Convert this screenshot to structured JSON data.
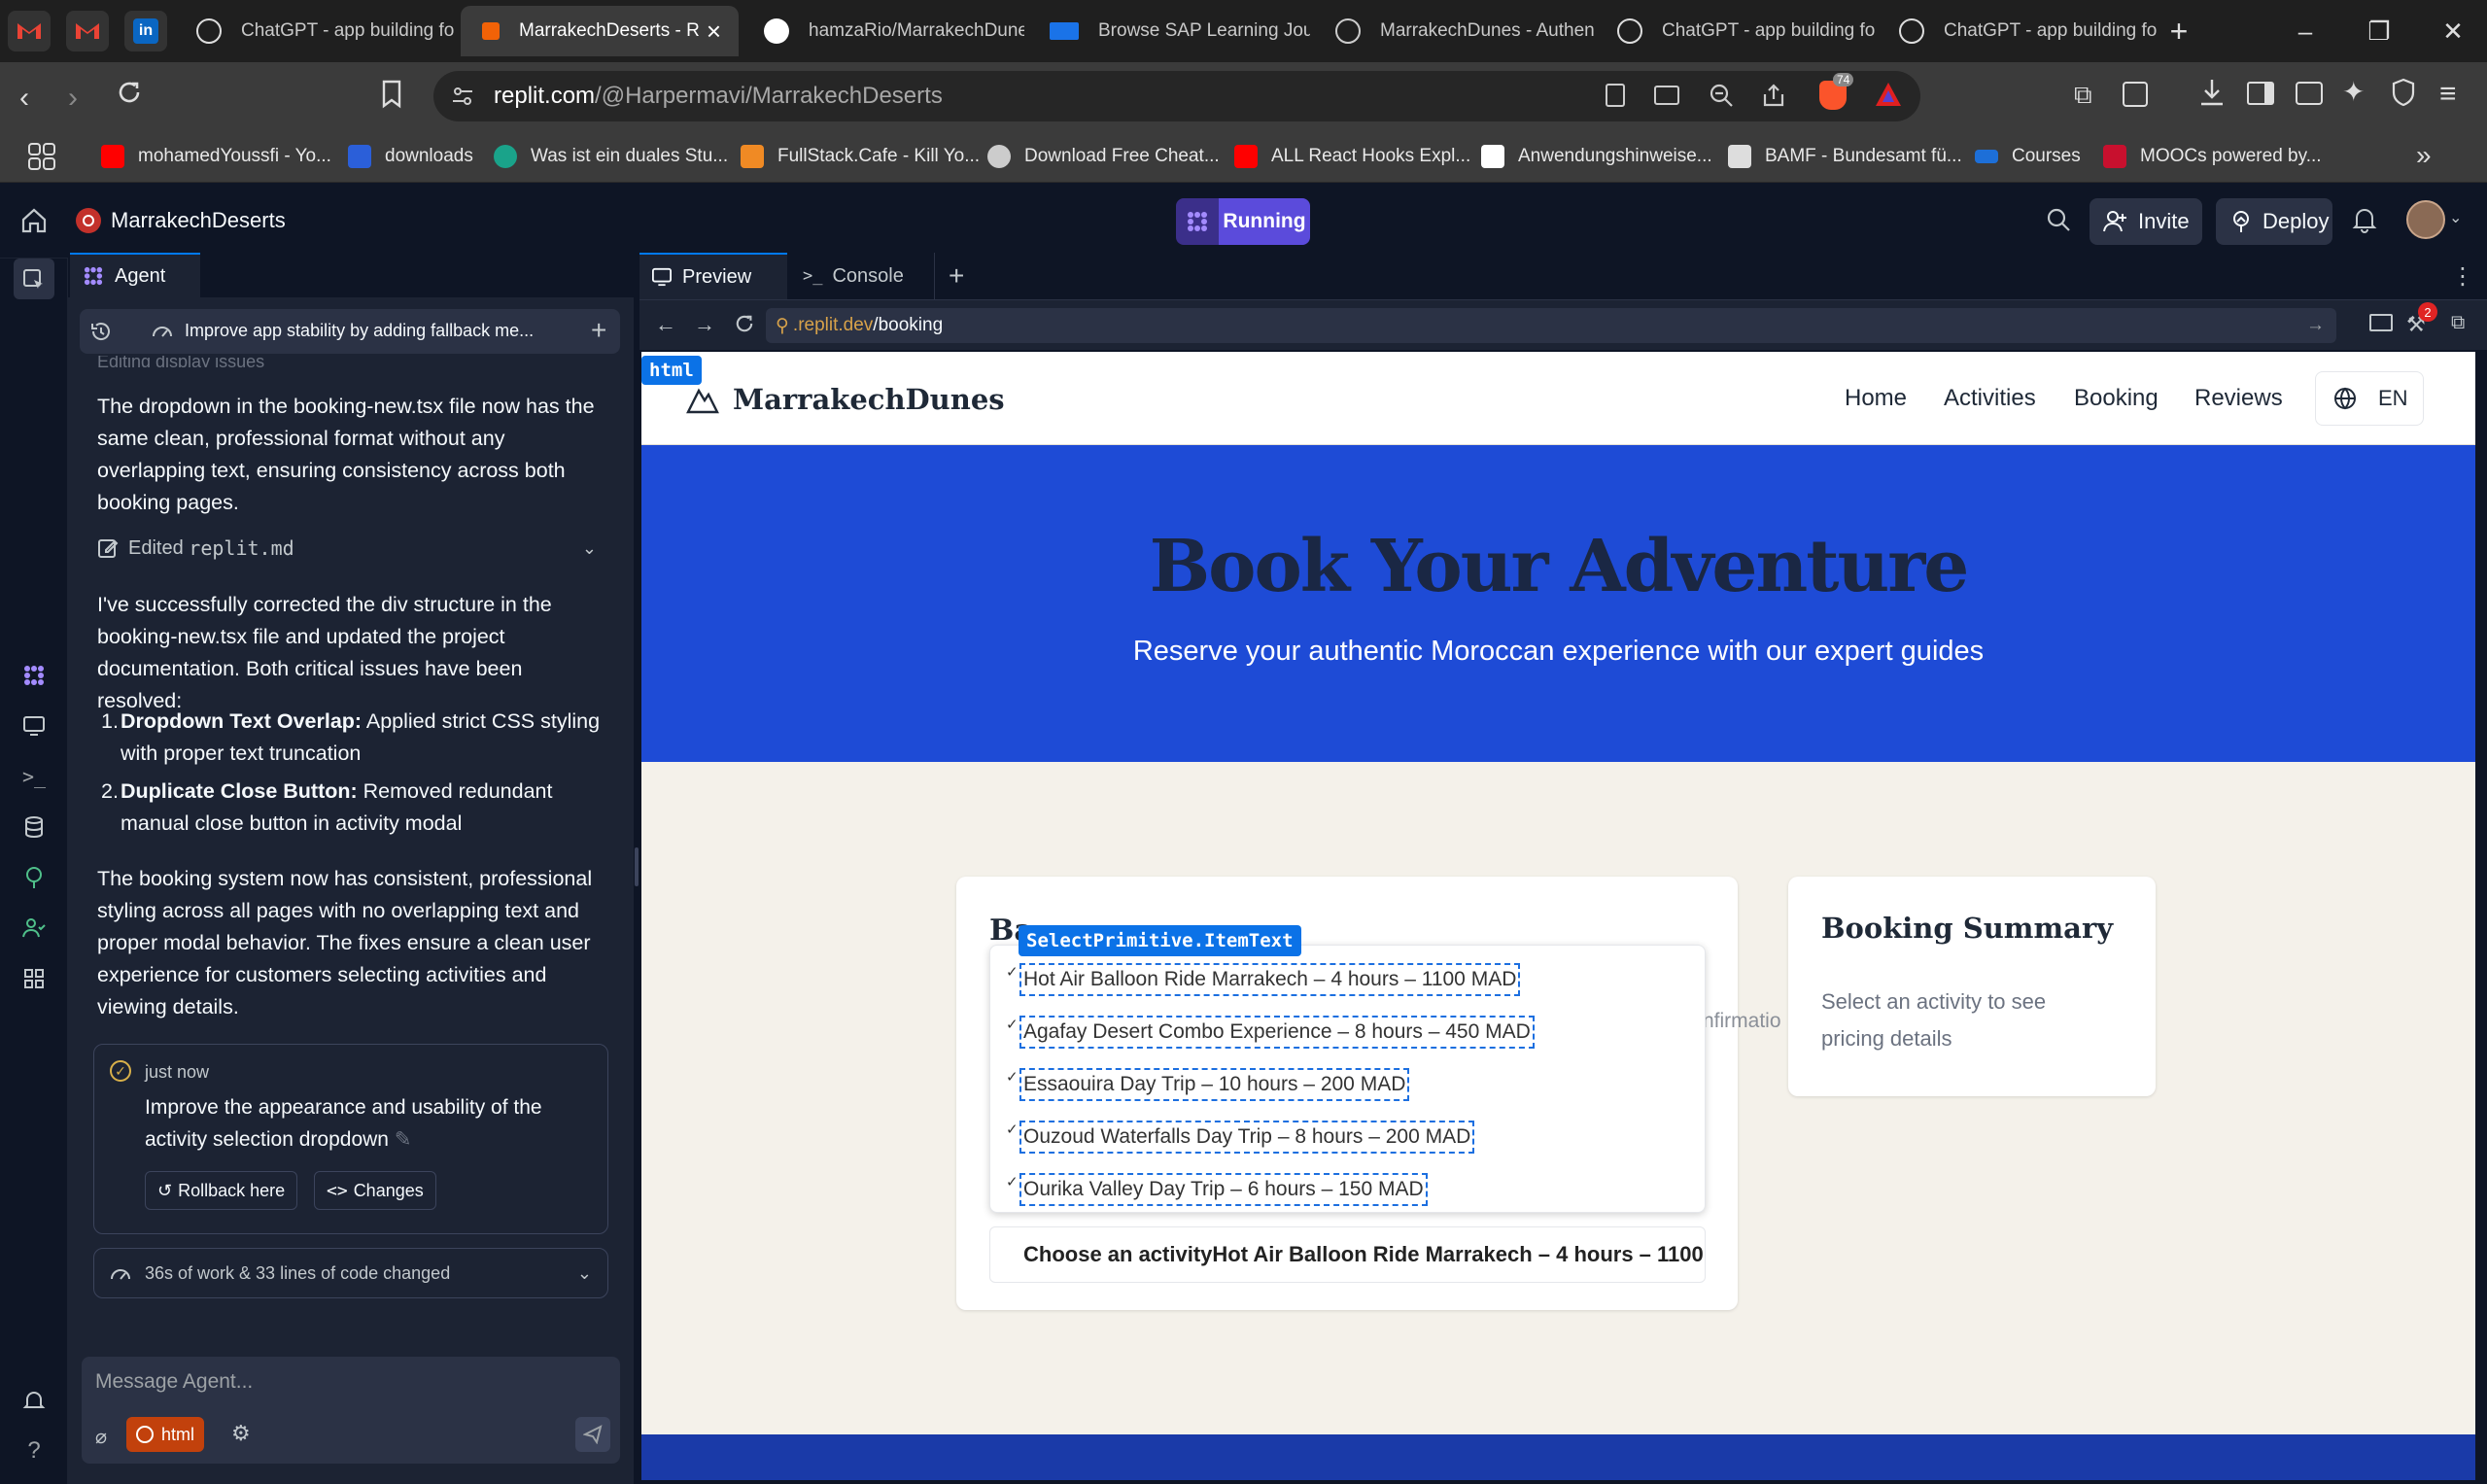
{
  "browser": {
    "tabs": [
      {
        "title": "ChatGPT - app building fo",
        "icon": "chatgpt-icon"
      },
      {
        "title": "MarrakechDeserts - R",
        "icon": "replit-icon",
        "active": true
      },
      {
        "title": "hamzaRio/MarrakechDune",
        "icon": "github-icon"
      },
      {
        "title": "Browse SAP Learning Jour",
        "icon": "sap-icon"
      },
      {
        "title": "MarrakechDunes - Authen",
        "icon": "globe-icon"
      },
      {
        "title": "ChatGPT - app building fo",
        "icon": "chatgpt-icon"
      },
      {
        "title": "ChatGPT - app building fo",
        "icon": "chatgpt-icon"
      }
    ],
    "url_host": "replit.com",
    "url_path": "/@Harpermavi/MarrakechDeserts",
    "shield_badge": "74",
    "bookmarks": [
      {
        "label": "mohamedYoussfi - Yo...",
        "color": "#ff0000"
      },
      {
        "label": "downloads",
        "color": "#2b5fd9"
      },
      {
        "label": "Was ist ein duales Stu...",
        "color": "#1aa38a"
      },
      {
        "label": "FullStack.Cafe - Kill Yo...",
        "color": "#f08a24"
      },
      {
        "label": "Download Free Cheat...",
        "color": "#cccccc"
      },
      {
        "label": "ALL React Hooks Expl...",
        "color": "#ff0000"
      },
      {
        "label": "Anwendungshinweise...",
        "color": "#ffffff"
      },
      {
        "label": "BAMF - Bundesamt fü...",
        "color": "#dddddd"
      },
      {
        "label": "Courses",
        "color": "#1d6fd8"
      },
      {
        "label": "MOOCs powered by...",
        "color": "#c8102e"
      }
    ]
  },
  "replit": {
    "project_name": "MarrakechDeserts",
    "run_status": "Running",
    "invite_label": "Invite",
    "deploy_label": "Deploy"
  },
  "agent": {
    "tab_label": "Agent",
    "history_title": "Improve app stability by adding fallback me...",
    "faded_line": "Editing display issues",
    "msg1": "The dropdown in the booking-new.tsx file now has the same clean, professional format without any overlapping text, ensuring consistency across both booking pages.",
    "edited_prefix": "Edited",
    "edited_file": "replit.md",
    "msg2": "I've successfully corrected the div structure in the booking-new.tsx file and updated the project documentation. Both critical issues have been resolved:",
    "fixes": [
      {
        "num": "1.",
        "title": "Dropdown Text Overlap:",
        "desc": "Applied strict CSS styling with proper text truncation"
      },
      {
        "num": "2.",
        "title": "Duplicate Close Button:",
        "desc": "Removed redundant manual close button in activity modal"
      }
    ],
    "msg3": "The booking system now has consistent, professional styling across all pages with no overlapping text and proper modal behavior. The fixes ensure a clean user experience for customers selecting activities and viewing details.",
    "checkpoint_time": "just now",
    "checkpoint_text": "Improve the appearance and usability of the activity selection dropdown",
    "rollback_label": "Rollback here",
    "changes_label": "Changes",
    "work_summary": "36s of work & 33 lines of code changed",
    "input_placeholder": "Message Agent...",
    "context_chip": "html"
  },
  "preview": {
    "tabs": [
      {
        "label": "Preview",
        "icon": "monitor-icon"
      },
      {
        "label": "Console",
        "icon": "terminal-icon"
      }
    ],
    "url_prefix": ".replit.dev",
    "url_path": "/booking",
    "devtools_badge": "2",
    "html_label": "html",
    "select_label": "SelectPrimitive.ItemText"
  },
  "site": {
    "brand": "MarrakechDunes",
    "nav": [
      "Home",
      "Activities",
      "Booking",
      "Reviews"
    ],
    "lang": "EN",
    "hero_title": "Book Your Adventure",
    "hero_subtitle": "Reserve your authentic Moroccan experience with our expert guides",
    "form_title_partial": "Ba",
    "confirmation_partial": "nfirmatio",
    "dropdown_options": [
      "Hot Air Balloon Ride Marrakech – 4 hours – 1100 MAD",
      "Agafay Desert Combo Experience – 8 hours – 450 MAD",
      "Essaouira Day Trip – 10 hours – 200 MAD",
      "Ouzoud Waterfalls Day Trip – 8 hours – 200 MAD",
      "Ourika Valley Day Trip – 6 hours – 150 MAD"
    ],
    "select_value": "Choose an activityHot Air Balloon Ride Marrakech – 4 hours – 1100...",
    "summary_title": "Booking Summary",
    "summary_text": "Select an activity to see pricing details"
  },
  "colors": {
    "replit_bg": "#0e1525",
    "panel_bg": "#1c2333",
    "running_purple": "#5b4bdb",
    "hero_blue": "#1e4bd6",
    "dev_label_blue": "#0b72e7",
    "brave_orange": "#fb542b"
  }
}
